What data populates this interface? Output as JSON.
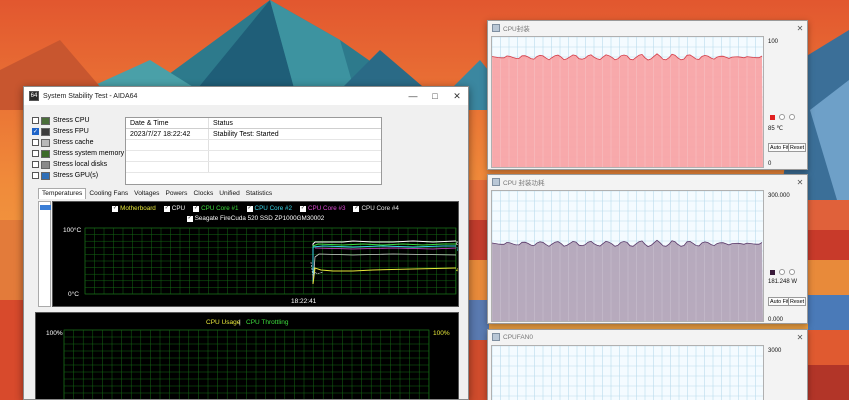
{
  "main_window": {
    "title": "System Stability Test - AIDA64",
    "stress_options": [
      {
        "label": "Stress CPU",
        "checked": false,
        "icon": "cpu-icon"
      },
      {
        "label": "Stress FPU",
        "checked": true,
        "icon": "fpu-icon"
      },
      {
        "label": "Stress cache",
        "checked": false,
        "icon": "cache-icon"
      },
      {
        "label": "Stress system memory",
        "checked": false,
        "icon": "memory-icon"
      },
      {
        "label": "Stress local disks",
        "checked": false,
        "icon": "disk-icon"
      },
      {
        "label": "Stress GPU(s)",
        "checked": false,
        "icon": "gpu-icon"
      }
    ],
    "status_table": {
      "headers": [
        "Date & Time",
        "Status"
      ],
      "rows": [
        [
          "2023/7/27 18:22:42",
          "Stability Test: Started"
        ]
      ]
    },
    "tabs": [
      "Temperatures",
      "Cooling Fans",
      "Voltages",
      "Powers",
      "Clocks",
      "Unified",
      "Statistics"
    ],
    "active_tab": "Temperatures",
    "temp_graph": {
      "legend_row1": [
        {
          "label": "Motherboard",
          "color": "#e8e83a"
        },
        {
          "label": "CPU",
          "color": "#ffffff"
        },
        {
          "label": "CPU Core #1",
          "color": "#3ddc3d"
        },
        {
          "label": "CPU Core #2",
          "color": "#38d6e8"
        },
        {
          "label": "CPU Core #3",
          "color": "#e04ad8"
        },
        {
          "label": "CPU Core #4",
          "color": "#e8e8e8"
        }
      ],
      "legend_row2": [
        {
          "label": "Seagate FireCuda 520 SSD ZP1000GM30002",
          "color": "#ffffff"
        }
      ],
      "y_top": "100°C",
      "y_bottom": "0°C",
      "time_label": "18:22:41",
      "value_labels": [
        "85",
        "84",
        "76",
        "56",
        "40",
        "45"
      ]
    },
    "usage_graph": {
      "legend": [
        "CPU Usage",
        "|",
        "CPU Throttling"
      ],
      "left_top": "100%",
      "right_top": "100%"
    }
  },
  "monitors": [
    {
      "title": "CPU封装",
      "max": "100",
      "current": "85 ℃",
      "min": "0",
      "swatch_color": "#e02020",
      "fill_color": "#f8a4a6",
      "line_color": "#d43c48",
      "level": 0.85,
      "buttons": [
        "Auto Fit",
        "Reset"
      ]
    },
    {
      "title": "CPU 封装功耗",
      "max": "300.000",
      "current": "181.248 W",
      "min": "0.000",
      "swatch_color": "#3a1a3a",
      "fill_color": "#b3a5b9",
      "line_color": "#5a3a6a",
      "level": 0.6,
      "buttons": [
        "Auto Fit",
        "Reset"
      ]
    },
    {
      "title": "CPUFAN0",
      "max": "3000"
    }
  ]
}
